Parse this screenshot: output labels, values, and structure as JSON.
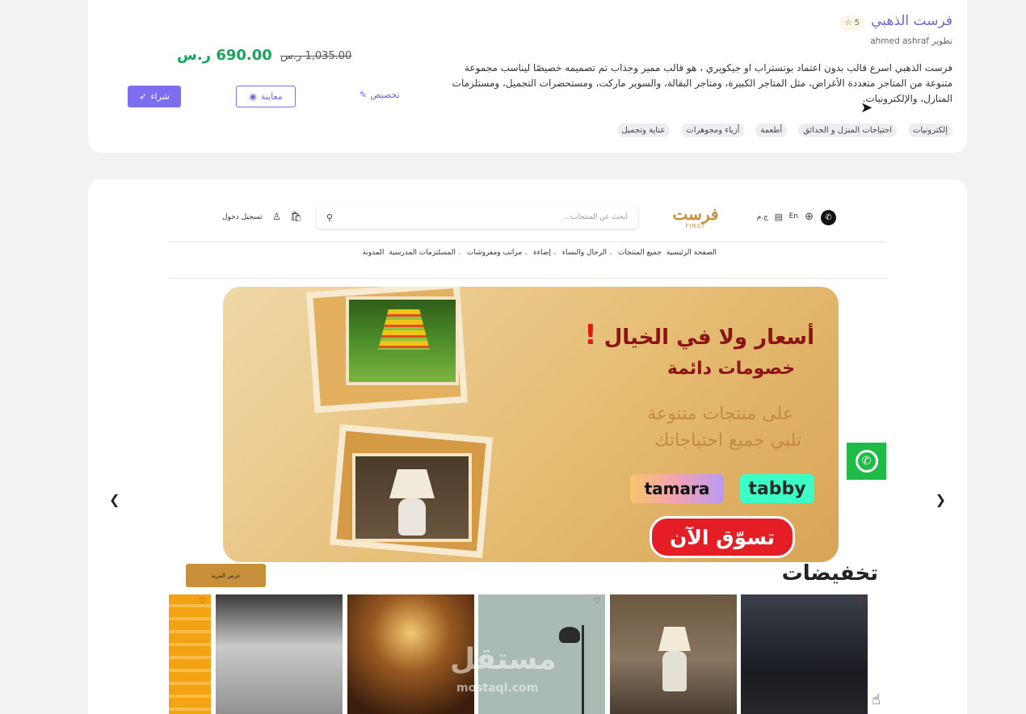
{
  "product": {
    "title": "فرست الذهبي",
    "rating": "5",
    "developer": "تطوير ahmed ashraf",
    "description": "فرست الذهبي اسرع قالب بدون اعتماد بوتستراب او جيكويري ، هو قالب مميز وجذاب تم تصميمه خصيصًا ليناسب مجموعة متنوعة من المتاجر متعددة الأغراض، مثل المتاجر الكبيرة، ومتاجر البقالة، والسوبر ماركت، ومستحضرات التجميل، ومستلزمات المنازل، والإلكترونيات.",
    "price_new": "690.00 ر.س",
    "price_old": "1,035.00 ر.س",
    "buy_label": "شراء",
    "preview_label": "معاينة",
    "customize_label": "تخصيص",
    "tags": [
      "إلكترونيات",
      "احتياجات المنزل و الحدائق",
      "أطعمة",
      "أزياء ومجوهرات",
      "عناية وتجميل"
    ]
  },
  "store": {
    "lang": "En",
    "currency": "ج.م",
    "logo_ar": "فرست",
    "logo_en": "FIRST",
    "search_placeholder": "ابحث عن المنتجات...",
    "login": "تسجيل دخول",
    "nav": [
      {
        "label": "الصفحة الرئيسية",
        "dropdown": false
      },
      {
        "label": "جميع المنتجات",
        "dropdown": false
      },
      {
        "label": "الرجال والنساء",
        "dropdown": true
      },
      {
        "label": "إضاءة",
        "dropdown": true
      },
      {
        "label": "مراتب ومفروشات",
        "dropdown": true
      },
      {
        "label": "المسلتزمات المدرسية",
        "dropdown": true
      },
      {
        "label": "المدونة",
        "dropdown": false
      }
    ],
    "banner": {
      "line1": "أسعار ولا في الخيال",
      "exclaim": "!",
      "line2": "خصومات دائمة",
      "line3": "على منتجات متنوعة",
      "line4": "تلبي جميع احتياجاتك",
      "tabby": "tabby",
      "tamara": "tamara",
      "cta": "تسوّق الآن"
    },
    "section_title": "تخفيضات",
    "more_label": "عرض المزيد",
    "watermark": "مستقل",
    "watermark_en": "mostaql.com"
  },
  "icons": {
    "heart": "♡",
    "prev": "‹",
    "next": "›"
  }
}
